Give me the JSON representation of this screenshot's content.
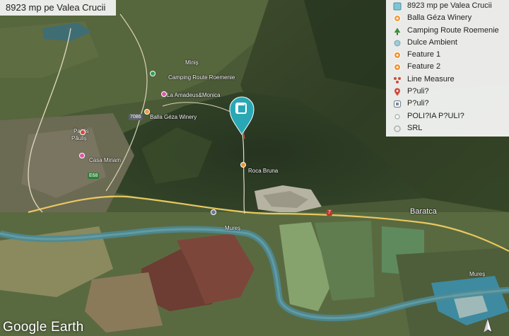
{
  "title": "8923 mp pe Valea Crucii",
  "legend": [
    {
      "label": "8923 mp pe Valea Crucii",
      "icon": "parcel-icon",
      "color": "#7cc7d6"
    },
    {
      "label": "Balla Géza Winery",
      "icon": "winery-icon",
      "color": "#f39b3a"
    },
    {
      "label": "Camping Route Roemenie",
      "icon": "tree-icon",
      "color": "#3c8f3c"
    },
    {
      "label": "Dulce Ambient",
      "icon": "dot-icon",
      "color": "#9ecbd6"
    },
    {
      "label": "Feature 1",
      "icon": "pin-orange-icon",
      "color": "#f0912f"
    },
    {
      "label": "Feature 2",
      "icon": "pin-orange-icon",
      "color": "#f0912f"
    },
    {
      "label": "Line Measure",
      "icon": "measure-icon",
      "color": "#c0503a"
    },
    {
      "label": "P?uli?",
      "icon": "map-pin-icon",
      "color": "#d2483c"
    },
    {
      "label": "P?uli?",
      "icon": "square-pin-icon",
      "color": "#7a8a95"
    },
    {
      "label": "POLI?IA P?ULI?",
      "icon": "dot-small-icon",
      "color": "#9ea8ad"
    },
    {
      "label": "SRL",
      "icon": "ring-icon",
      "color": "#9ea8ad"
    }
  ],
  "map_labels": {
    "paulis_red": "Paulis",
    "paulis": "Păuliș",
    "casa": "Casa Miriam",
    "winery": "Balla Géza Winery",
    "amadeus": "La Amadeus&Monica",
    "camping": "Camping Route Roemenie",
    "minis": "Miniș",
    "roca": "Roca Bruna",
    "baratca": "Baratca",
    "mures1": "Mureș",
    "mures2": "Mureș"
  },
  "roads": {
    "e68": "E68",
    "r7086": "7086",
    "r7": "7"
  },
  "brand": "Google Earth",
  "colors": {
    "marker": "#2aa7b5",
    "river": "#4d8a95",
    "road": "#e9c860"
  }
}
